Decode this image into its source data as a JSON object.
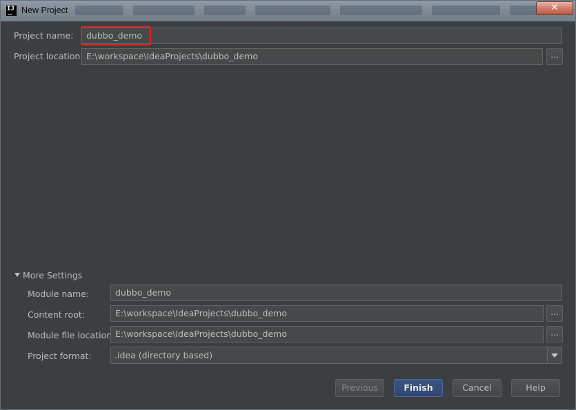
{
  "window": {
    "title": "New Project",
    "app_icon_text": "IJ",
    "close_symbol": "✕"
  },
  "project": {
    "name_label": "Project name:",
    "name_value": "dubbo_demo",
    "location_label": "Project location:",
    "location_value": "E:\\workspace\\IdeaProjects\\dubbo_demo",
    "browse_symbol": "..."
  },
  "more_settings": {
    "toggle_label": "More Settings",
    "module_name_label": "Module name:",
    "module_name_value": "dubbo_demo",
    "content_root_label": "Content root:",
    "content_root_value": "E:\\workspace\\IdeaProjects\\dubbo_demo",
    "module_file_label": "Module file location:",
    "module_file_value": "E:\\workspace\\IdeaProjects\\dubbo_demo",
    "format_label": "Project format:",
    "format_value": ".idea (directory based)"
  },
  "buttons": {
    "previous": "Previous",
    "finish": "Finish",
    "cancel": "Cancel",
    "help": "Help"
  },
  "colors": {
    "background": "#3c3f41",
    "field": "#45494a",
    "highlight_box": "#e0241a",
    "default_button": "#365080"
  },
  "icons": [
    "app-logo-icon",
    "close-icon",
    "browse-icon",
    "collapse-triangle-icon",
    "dropdown-arrow-icon"
  ]
}
